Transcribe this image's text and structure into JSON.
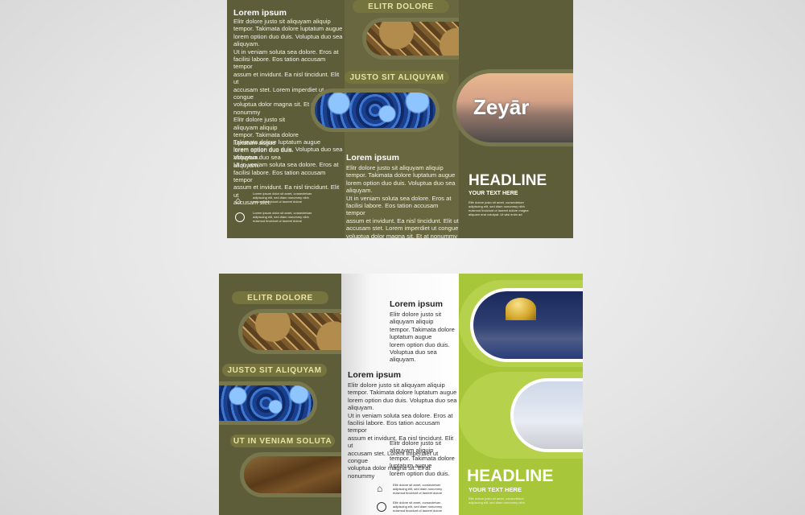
{
  "top": {
    "left_title": "Lorem ipsum",
    "left_body": "Elitr dolore justo sit aliquyam aliquip\ntempor. Takimata dolore luptatum augue\nlorem option duo duis. Voluptua duo sea\naliquyam.\nUt in veniam soluta sea dolore. Eros at\nfacilisi labore. Eos tation accusam tempor\nassum et invidunt. Ea nisl tincidunt. Elit ut\naccusam stet. Lorem imperdiet ut congue\nvoluptua dolor magna sit. Et at nonummy\nElitr dolore justo sit\naliquyam aliquip\ntempor. Takimata dolore\nluptatum augue\nlorem option duo duis.\nVoluptua duo sea\naliquyam.",
    "left_body2": "Takimata dolore luptatum augue\nlorem option duo duis. Voluptua duo sea\naliquyam.\nUt in veniam soluta sea dolore. Eros at\nfacilisi labore. Eos tation accusam tempor\nassum et invidunt. Ea nisl tincidunt. Elit ut\naccusam stet.",
    "tag1": "ELITR DOLORE",
    "tag2": "JUSTO SIT ALIQUYAM",
    "mid_title": "Lorem ipsum",
    "mid_body": "Elitr dolore justo sit aliquyam aliquip\ntempor. Takimata dolore luptatum augue\nlorem option duo duis. Voluptua duo sea\naliquyam.\nUt in veniam soluta sea dolore. Eros at\nfacilisi labore. Eos tation accusam tempor\nassum et invidunt. Ea nisl tincidunt. Elit ut\naccusam stet. Lorem imperdiet ut congue\nvoluptua dolor magna sit. Et at nonummy",
    "logo": "Zeyār",
    "headline": "HEADLINE",
    "subline": "YOUR TEXT HERE",
    "fine": "Elitr dolore justo sit amet, consectetuer\nadipiscing elit, sed diam nonummy nibh\neuismod tincidunt ut laoreet dolore magna\naliquam erat volutpat. Ut wisi enim ad",
    "contact": "Lorem ipsum dolor sit amet, consectetuer\nadipiscing elit, sed diam nonummy nibh\neuismod tincidunt ut laoreet dolore"
  },
  "bottom": {
    "tag1": "ELITR DOLORE",
    "tag2": "JUSTO SIT ALIQUYAM",
    "tag3": "UT IN VENIAM SOLUTA",
    "title1": "Lorem ipsum",
    "body1": "Elitr dolore justo sit\naliquyam aliquip\ntempor. Takimata dolore\nluptatum augue\nlorem option duo duis.\nVoluptua duo sea\naliquyam.",
    "title2": "Lorem ipsum",
    "body2": "Elitr dolore justo sit aliquyam aliquip\ntempor. Takimata dolore luptatum augue\nlorem option duo duis. Voluptua duo sea\naliquyam.\nUt in veniam soluta sea dolore. Eros at\nfacilisi labore. Eos tation accusam tempor\nassum et invidunt. Ea nisl tincidunt. Elit ut\naccusam stet. Lorem imperdiet ut congue\nvoluptua dolor magna sit. Et at nonummy",
    "body3": "Elitr dolore justo sit\naliquyam aliquip\ntempor. Takimata dolore\nluptatum augue\nlorem option duo duis.",
    "contact": "Elitr dolore sit amet, consectetuer\nadipiscing elit, sed diam nonummy\neuismod tincidunt ut laoreet dolore",
    "headline": "HEADLINE",
    "subline": "YOUR TEXT HERE",
    "fine": "Elitr dolore justo sit amet, consectetuer\nadipiscing elit, sed diam nonummy nibh"
  },
  "colors": {
    "olive": "#5e5d3a",
    "lime": "#a8c63a",
    "tag": "#e8e2a6"
  }
}
